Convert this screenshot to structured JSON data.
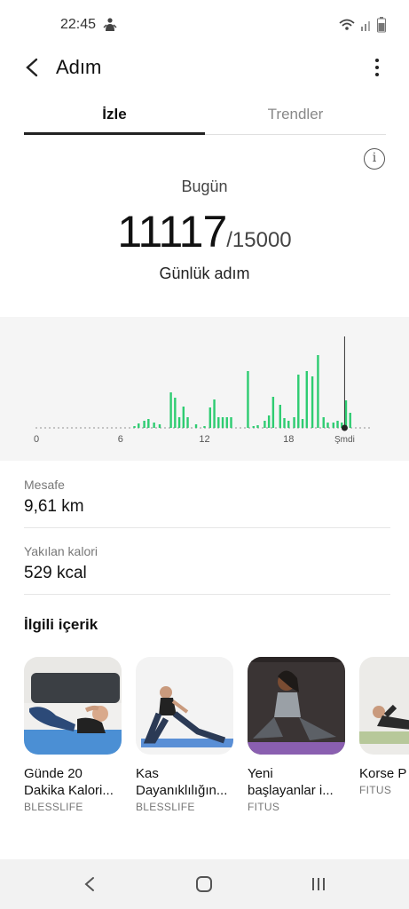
{
  "status": {
    "time": "22:45"
  },
  "app": {
    "title": "Adım"
  },
  "tabs": [
    {
      "label": "İzle"
    },
    {
      "label": "Trendler"
    }
  ],
  "summary": {
    "today_label": "Bugün",
    "steps": "11117",
    "goal": "/15000",
    "daily_label": "Günlük adım"
  },
  "chart_data": {
    "type": "bar",
    "x_ticks": [
      "0",
      "6",
      "12",
      "18",
      "Şmdi"
    ],
    "x": [
      7.0,
      7.3,
      7.7,
      8.0,
      8.4,
      8.8,
      9.6,
      9.9,
      10.2,
      10.5,
      10.8,
      11.4,
      12.0,
      12.4,
      12.7,
      13.0,
      13.3,
      13.6,
      13.9,
      15.1,
      15.5,
      15.8,
      16.3,
      16.6,
      16.9,
      17.4,
      17.7,
      18.0,
      18.4,
      18.7,
      19.0,
      19.3,
      19.7,
      20.1,
      20.5,
      20.8,
      21.2,
      21.5,
      21.8,
      22.1,
      22.4
    ],
    "values": [
      2,
      5,
      8,
      10,
      6,
      4,
      40,
      34,
      12,
      24,
      12,
      4,
      2,
      23,
      32,
      12,
      12,
      12,
      12,
      64,
      2,
      3,
      8,
      14,
      35,
      26,
      11,
      8,
      12,
      60,
      10,
      64,
      58,
      82,
      12,
      6,
      6,
      8,
      6,
      31,
      17
    ],
    "now_x": 22.0,
    "xlim": [
      0,
      24
    ],
    "ylim": [
      0,
      110
    ],
    "bar_color": "#2ecc71"
  },
  "stats": [
    {
      "label": "Mesafe",
      "value": "9,61 km"
    },
    {
      "label": "Yakılan kalori",
      "value": "529 kcal"
    }
  ],
  "related": {
    "title": "İlgili içerik",
    "cards": [
      {
        "title": "Günde 20\nDakika Kalori...",
        "provider": "BLESSLIFE"
      },
      {
        "title": "Kas\nDayanıklılığın...",
        "provider": "BLESSLIFE"
      },
      {
        "title": "Yeni\nbaşlayanlar i...",
        "provider": "FITUS"
      },
      {
        "title": "Korse P",
        "provider": "FITUS"
      }
    ]
  }
}
